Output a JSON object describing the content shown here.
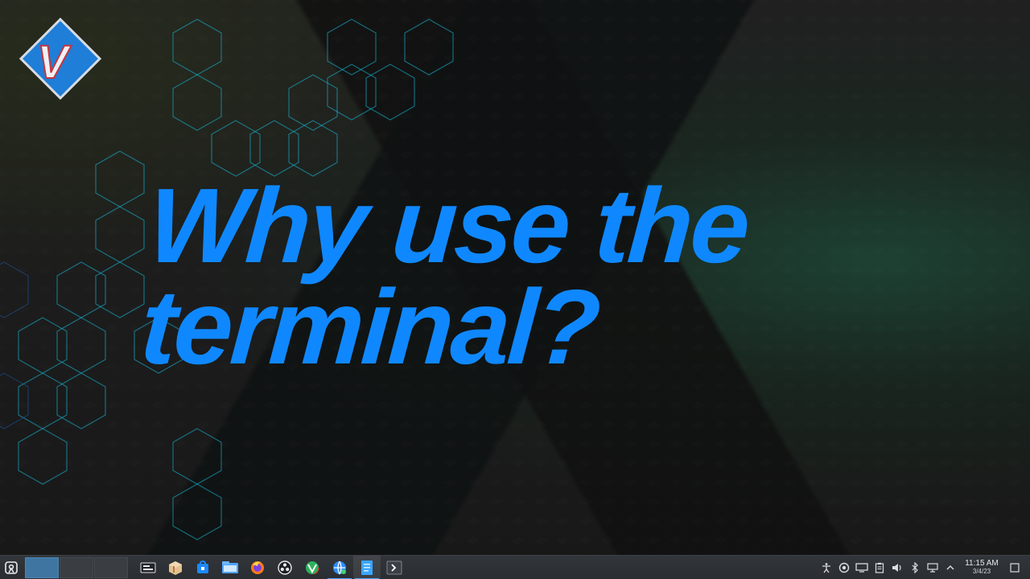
{
  "headline": {
    "line1": "Why use the",
    "line2": "terminal?"
  },
  "branding": {
    "logo_letter": "V"
  },
  "taskbar": {
    "pager": {
      "desktops": 3,
      "active_index": 0
    },
    "launchers": [
      {
        "name": "system-monitor-icon",
        "active": false
      },
      {
        "name": "package-manager-icon",
        "active": false
      },
      {
        "name": "software-store-icon",
        "active": false
      },
      {
        "name": "file-manager-icon",
        "active": false
      },
      {
        "name": "firefox-icon",
        "active": false
      },
      {
        "name": "obs-icon",
        "active": false
      },
      {
        "name": "vivaldi-icon",
        "active": false
      },
      {
        "name": "network-browser-icon",
        "active": true
      },
      {
        "name": "text-editor-icon",
        "active": true,
        "focused": true
      },
      {
        "name": "terminal-icon",
        "active": false
      }
    ],
    "tray": {
      "icons": [
        "accessibility-icon",
        "updates-icon",
        "display-icon",
        "clipboard-icon",
        "volume-icon",
        "bluetooth-icon",
        "network-icon",
        "expand-tray-icon"
      ],
      "time": "11:15 AM",
      "date": "3/4/23"
    }
  },
  "colors": {
    "headline": "#0f88ff",
    "taskbar": "#2d3035",
    "accent": "#4aa3ff"
  }
}
